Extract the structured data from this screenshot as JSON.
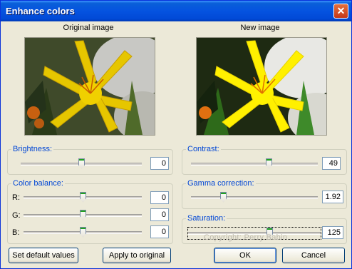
{
  "window": {
    "title": "Enhance colors",
    "close_glyph": "✕"
  },
  "images": {
    "original_caption": "Original image",
    "new_caption": "New image"
  },
  "brightness": {
    "label": "Brightness:",
    "value": "0",
    "level": 0.5
  },
  "color_balance": {
    "label": "Color balance:",
    "rows": [
      {
        "label": "R:",
        "value": "0",
        "level": 0.5
      },
      {
        "label": "G:",
        "value": "0",
        "level": 0.5
      },
      {
        "label": "B:",
        "value": "0",
        "level": 0.5
      }
    ]
  },
  "contrast": {
    "label": "Contrast:",
    "value": "49",
    "level": 0.62
  },
  "gamma": {
    "label": "Gamma correction:",
    "value": "1.92",
    "level": 0.24
  },
  "saturation": {
    "label": "Saturation:",
    "value": "125",
    "level": 0.62
  },
  "buttons": {
    "set_default": "Set default values",
    "apply_original": "Apply to original",
    "ok": "OK",
    "cancel": "Cancel"
  },
  "watermark": "Copyright: Perry Babin",
  "colors": {
    "title_bar": "#0553e0",
    "group_label": "#0046d5",
    "dialog_bg": "#ece9d8",
    "flower": "#f6d800"
  }
}
